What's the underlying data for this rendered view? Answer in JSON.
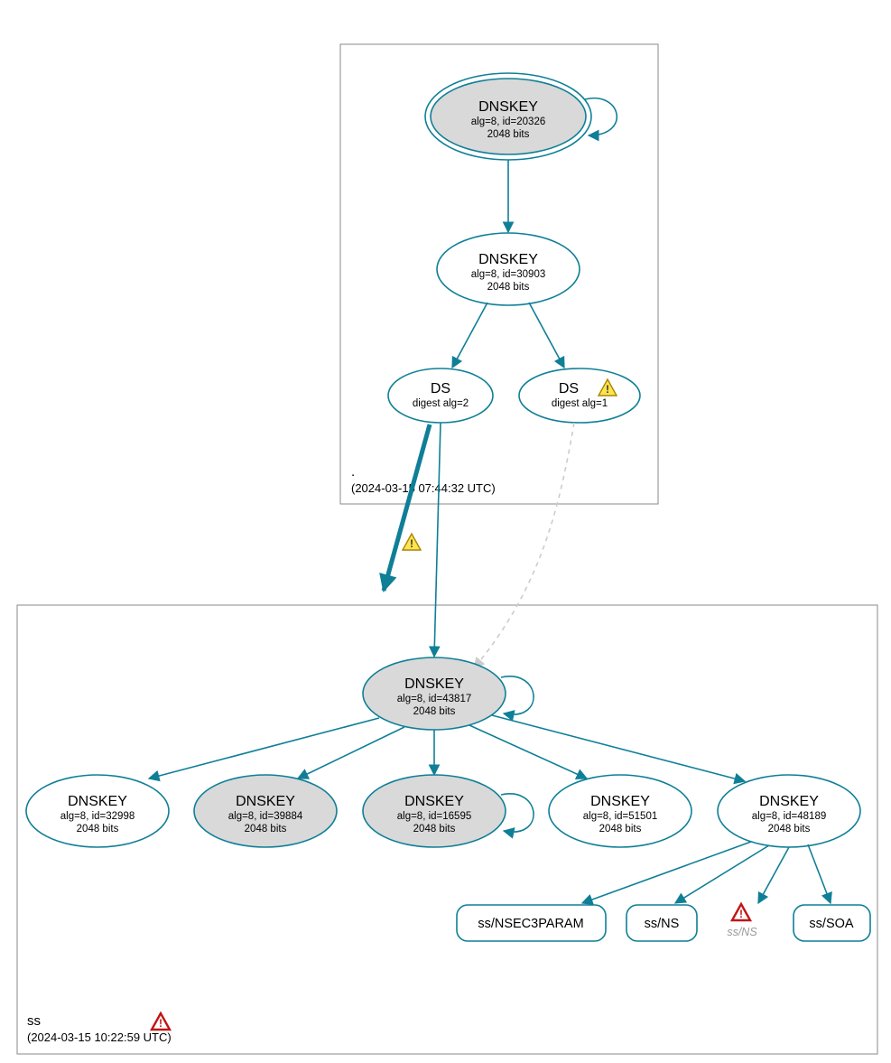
{
  "zones": {
    "root": {
      "label": ".",
      "timestamp": "(2024-03-15 07:44:32 UTC)"
    },
    "ss": {
      "label": "ss",
      "timestamp": "(2024-03-15 10:22:59 UTC)"
    }
  },
  "nodes": {
    "root_ksk": {
      "title": "DNSKEY",
      "line2": "alg=8, id=20326",
      "line3": "2048 bits"
    },
    "root_zsk": {
      "title": "DNSKEY",
      "line2": "alg=8, id=30903",
      "line3": "2048 bits"
    },
    "ds2": {
      "title": "DS",
      "line2": "digest alg=2"
    },
    "ds1": {
      "title": "DS",
      "line2": "digest alg=1"
    },
    "ss_ksk": {
      "title": "DNSKEY",
      "line2": "alg=8, id=43817",
      "line3": "2048 bits"
    },
    "k32998": {
      "title": "DNSKEY",
      "line2": "alg=8, id=32998",
      "line3": "2048 bits"
    },
    "k39884": {
      "title": "DNSKEY",
      "line2": "alg=8, id=39884",
      "line3": "2048 bits"
    },
    "k16595": {
      "title": "DNSKEY",
      "line2": "alg=8, id=16595",
      "line3": "2048 bits"
    },
    "k51501": {
      "title": "DNSKEY",
      "line2": "alg=8, id=51501",
      "line3": "2048 bits"
    },
    "k48189": {
      "title": "DNSKEY",
      "line2": "alg=8, id=48189",
      "line3": "2048 bits"
    }
  },
  "rr": {
    "nsec3param": "ss/NSEC3PARAM",
    "ns": "ss/NS",
    "ns_error": "ss/NS",
    "soa": "ss/SOA"
  },
  "colors": {
    "primary": "#0f7f97",
    "node_fill_sep": "#d9d9d9",
    "warning_fill": "#ffe450",
    "warning_stroke": "#a88600",
    "error_stroke": "#c01515"
  }
}
